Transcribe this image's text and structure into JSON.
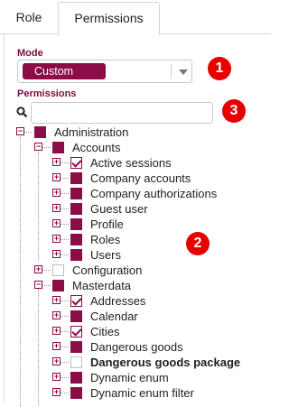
{
  "tabs": {
    "role": "Role",
    "permissions": "Permissions"
  },
  "mode": {
    "label": "Mode",
    "value": "Custom"
  },
  "permissions": {
    "label": "Permissions",
    "search_placeholder": ""
  },
  "callouts": [
    "1",
    "2",
    "3"
  ],
  "tree": [
    {
      "label": "Administration",
      "state": "filled",
      "bold": false
    },
    {
      "label": "Accounts",
      "state": "filled",
      "bold": false
    },
    {
      "label": "Active sessions",
      "state": "checked",
      "bold": false
    },
    {
      "label": "Company accounts",
      "state": "filled",
      "bold": false
    },
    {
      "label": "Company authorizations",
      "state": "filled",
      "bold": false
    },
    {
      "label": "Guest user",
      "state": "filled",
      "bold": false
    },
    {
      "label": "Profile",
      "state": "filled",
      "bold": false
    },
    {
      "label": "Roles",
      "state": "filled",
      "bold": false
    },
    {
      "label": "Users",
      "state": "filled",
      "bold": false
    },
    {
      "label": "Configuration",
      "state": "empty",
      "bold": false
    },
    {
      "label": "Masterdata",
      "state": "filled",
      "bold": false
    },
    {
      "label": "Addresses",
      "state": "checked",
      "bold": false
    },
    {
      "label": "Calendar",
      "state": "filled",
      "bold": false
    },
    {
      "label": "Cities",
      "state": "checked",
      "bold": false
    },
    {
      "label": "Dangerous goods",
      "state": "filled",
      "bold": false
    },
    {
      "label": "Dangerous goods package",
      "state": "empty",
      "bold": true
    },
    {
      "label": "Dynamic enum",
      "state": "filled",
      "bold": false
    },
    {
      "label": "Dynamic enum filter",
      "state": "filled",
      "bold": false
    }
  ],
  "colors": {
    "accent": "#8b0c47",
    "callout": "#e60000"
  }
}
